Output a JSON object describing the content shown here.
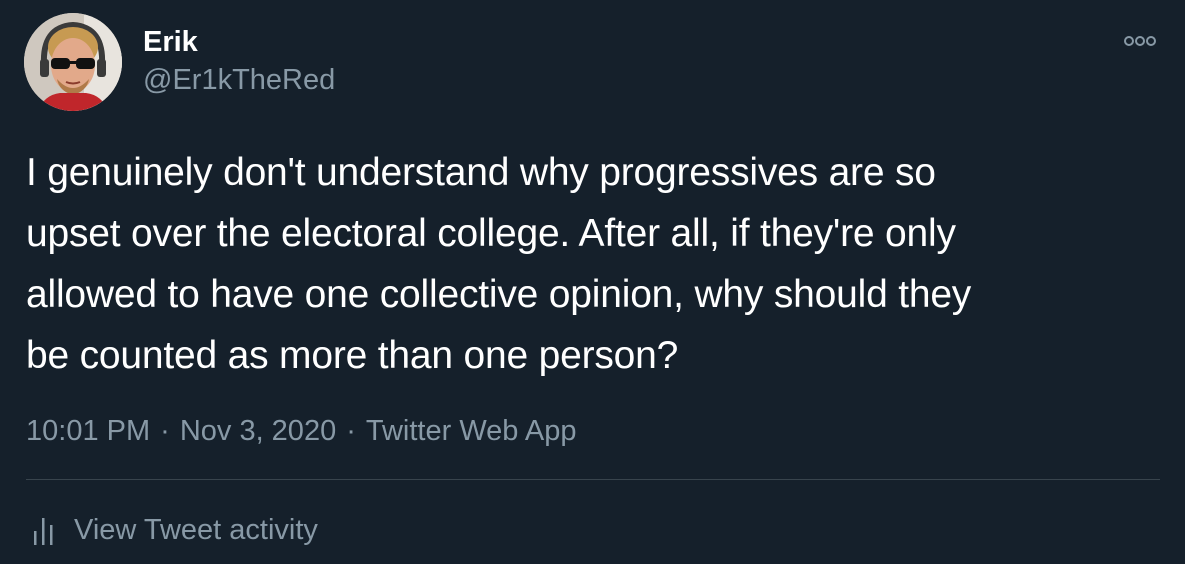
{
  "author": {
    "name": "Erik",
    "handle": "@Er1kTheRed"
  },
  "tweet": {
    "text": "I genuinely don't understand why progressives are so\nupset over the electoral college. After all, if they're only\nallowed to have one collective opinion, why should they\nbe counted as more than one person?",
    "time": "10:01 PM",
    "separator": "·",
    "date": "Nov 3, 2020",
    "source": "Twitter Web App"
  },
  "footer": {
    "activity_label": "View Tweet activity"
  },
  "colors": {
    "background": "#15202b",
    "primary_text": "#ffffff",
    "secondary_text": "#8899a6",
    "divider": "#38444d"
  },
  "icons": {
    "more": "more-dots-icon",
    "activity": "bar-chart-icon"
  }
}
